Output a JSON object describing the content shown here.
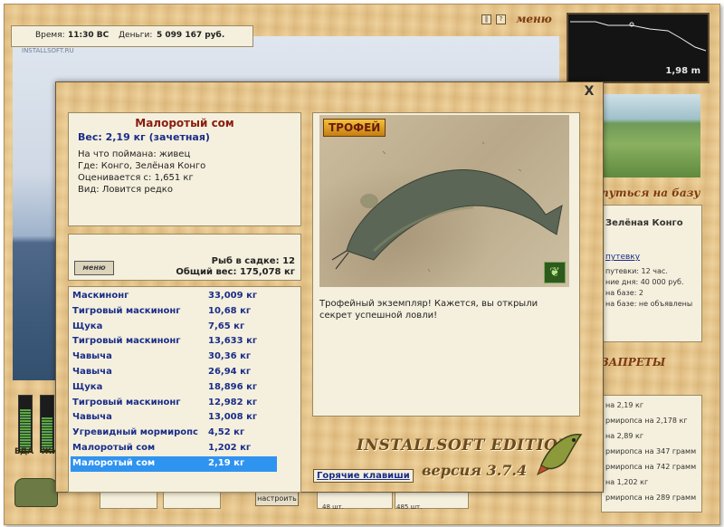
{
  "topbar": {
    "time_label": "Время:",
    "time_value": "11:30 ВС",
    "money_label": "Деньги:",
    "money_value": "5 099 167 руб."
  },
  "watermark": "INSTALLSOFT.RU",
  "top_menu": {
    "pause_icon": "pause-icon",
    "help_label": "?",
    "menu_label": "меню"
  },
  "depth": {
    "value": "1,98 m"
  },
  "right_panel": {
    "location_heading": "путься на базу",
    "location_name": "Зелёная Конго",
    "trip_link": "путевку",
    "lines": [
      "путевки: 12 час.",
      "ние дня: 40 000 руб.",
      "на базе: 2",
      "на базе: не объявлены"
    ],
    "bans_heading": "ЗАПРЕТЫ",
    "bans": [
      "на 2,19 кг",
      "рмиропса на 2,178 кг",
      "на 2,89 кг",
      "рмиропса на 347 грамм",
      "рмиропса на 742 грамм",
      "на 1,202 кг",
      "рмиропса на 289 грамм"
    ]
  },
  "gauges": {
    "food_label": "ЕДА",
    "label2": "ЖИ",
    "food_level": 0.75,
    "level2": 0.6
  },
  "bottom": {
    "setup_button": "настроить",
    "pcs1": "48 шт.",
    "pcs2": "485 шт."
  },
  "fish_info": {
    "name": "Малоротый сом",
    "weight": "Вес: 2,19 кг (зачетная)",
    "bait": "На что поймана: живец",
    "where": "Где: Конго, Зелёная Конго",
    "value": "Оценивается с: 1,651 кг",
    "kind": "Вид: Ловится редко"
  },
  "keepnet": {
    "menu_button": "меню",
    "count": "Рыб в садке: 12",
    "total_weight": "Общий вес: 175,078 кг"
  },
  "catch_list": [
    {
      "name": "Маскинонг",
      "weight": "33,009 кг"
    },
    {
      "name": "Тигровый маскинонг",
      "weight": "10,68 кг"
    },
    {
      "name": "Щука",
      "weight": "7,65 кг"
    },
    {
      "name": "Тигровый маскинонг",
      "weight": "13,633 кг"
    },
    {
      "name": "Чавыча",
      "weight": "30,36 кг"
    },
    {
      "name": "Чавыча",
      "weight": "26,94 кг"
    },
    {
      "name": "Щука",
      "weight": "18,896 кг"
    },
    {
      "name": "Тигровый маскинонг",
      "weight": "12,982 кг"
    },
    {
      "name": "Чавыча",
      "weight": "13,008 кг"
    },
    {
      "name": "Угревидный мормиропс",
      "weight": "4,52 кг"
    },
    {
      "name": "Малоротый сом",
      "weight": "1,202 кг"
    },
    {
      "name": "Малоротый сом",
      "weight": "2,19 кг"
    }
  ],
  "selected_index": 11,
  "trophy": {
    "badge": "ТРОФЕЙ",
    "text": "Трофейный экземпляр! Кажется, вы открыли секрет успешной ловли!"
  },
  "branding": {
    "edition": "INSTALLSOFT EDITION",
    "version": "версия 3.7.4"
  },
  "hotkeys_link": "Горячие клавиши",
  "close_label": "X"
}
